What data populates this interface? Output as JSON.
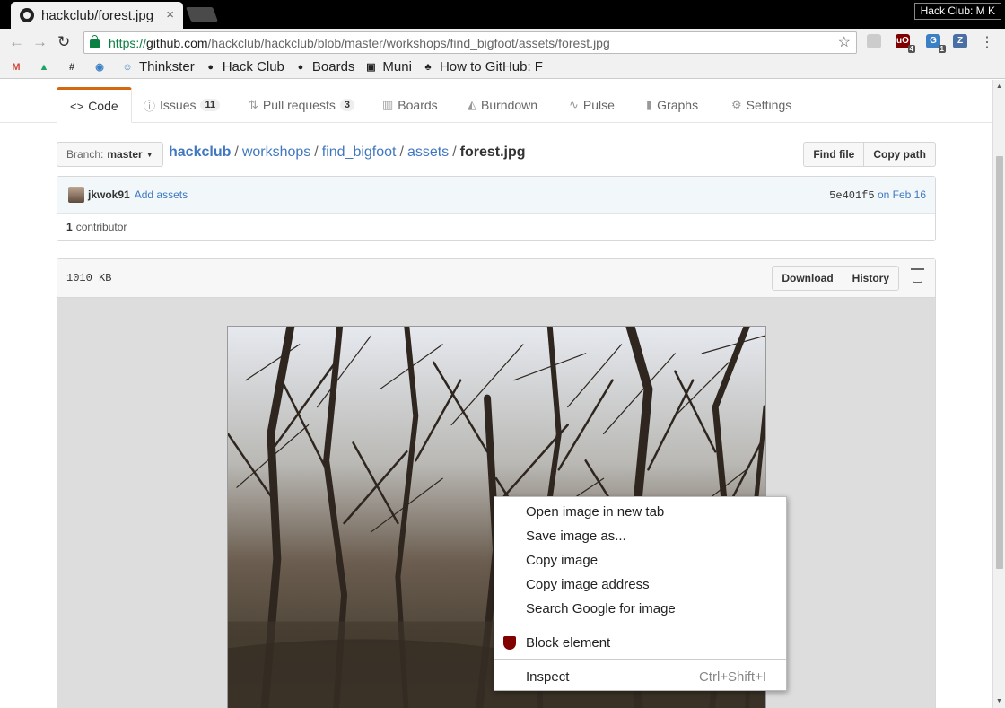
{
  "browser": {
    "tab_title": "hackclub/forest.jpg",
    "tab_close": "×",
    "profile_label": "Hack Club: M K",
    "url_scheme": "https://",
    "url_host": "github.com",
    "url_path": "/hackclub/hackclub/blob/master/workshops/find_bigfoot/assets/forest.jpg",
    "back_icon": "←",
    "forward_icon": "→",
    "reload_icon": "↻",
    "star_icon": "☆",
    "menu_icon": "⋮",
    "extensions": [
      {
        "name": "ublock-icon",
        "count": "4",
        "color": "#800000"
      },
      {
        "name": "ghostery-icon",
        "count": "1",
        "color": "#3b7fc4"
      },
      {
        "name": "zotero-icon",
        "count": "",
        "color": "#4a6fa5"
      }
    ]
  },
  "bookmarks": [
    {
      "label": "",
      "icon": "gmail-icon",
      "glyph": "M",
      "color": "#d44638"
    },
    {
      "label": "",
      "icon": "drive-icon",
      "glyph": "▲",
      "color": "#1fa463"
    },
    {
      "label": "",
      "icon": "slack-hash-icon",
      "glyph": "#",
      "color": "#333333"
    },
    {
      "label": "",
      "icon": "eye-icon",
      "glyph": "◉",
      "color": "#3a7fc4"
    },
    {
      "label": "Thinkster",
      "icon": "thinkster-icon",
      "glyph": "☺",
      "color": "#3a7fc4"
    },
    {
      "label": "Hack Club",
      "icon": "github-icon",
      "glyph": "●",
      "color": "#222222"
    },
    {
      "label": "Boards",
      "icon": "github-icon",
      "glyph": "●",
      "color": "#222222"
    },
    {
      "label": "Muni",
      "icon": "muni-icon",
      "glyph": "▣",
      "color": "#222222"
    },
    {
      "label": "How to GitHub: F",
      "icon": "spy-icon",
      "glyph": "♣",
      "color": "#222222"
    }
  ],
  "repo_nav": {
    "tabs": [
      {
        "label": "Code",
        "icon": "<>",
        "count": "",
        "selected": true
      },
      {
        "label": "Issues",
        "icon": "ⓘ",
        "count": "11",
        "selected": false
      },
      {
        "label": "Pull requests",
        "icon": "⇅",
        "count": "3",
        "selected": false
      },
      {
        "label": "Boards",
        "icon": "▥",
        "count": "",
        "selected": false
      },
      {
        "label": "Burndown",
        "icon": "◭",
        "count": "",
        "selected": false
      },
      {
        "label": "Pulse",
        "icon": "∿",
        "count": "",
        "selected": false
      },
      {
        "label": "Graphs",
        "icon": "▮",
        "count": "",
        "selected": false
      },
      {
        "label": "Settings",
        "icon": "⚙",
        "count": "",
        "selected": false
      }
    ]
  },
  "file_nav": {
    "branch_label": "Branch:",
    "branch_name": "master",
    "breadcrumb": [
      "hackclub",
      "workshops",
      "find_bigfoot",
      "assets"
    ],
    "filename": "forest.jpg",
    "separator": "/",
    "find_file": "Find file",
    "copy_path": "Copy path"
  },
  "commit": {
    "author": "jkwok91",
    "message": "Add assets",
    "sha": "5e401f5",
    "date_prefix": "on",
    "date": "Feb 16",
    "contributors_count": "1",
    "contributors_label": "contributor"
  },
  "file": {
    "size": "1010 KB",
    "download": "Download",
    "history": "History"
  },
  "context_menu": {
    "items": [
      "Open image in new tab",
      "Save image as...",
      "Copy image",
      "Copy image address",
      "Search Google for image"
    ],
    "block_element": "Block element",
    "inspect": "Inspect",
    "inspect_shortcut": "Ctrl+Shift+I"
  }
}
